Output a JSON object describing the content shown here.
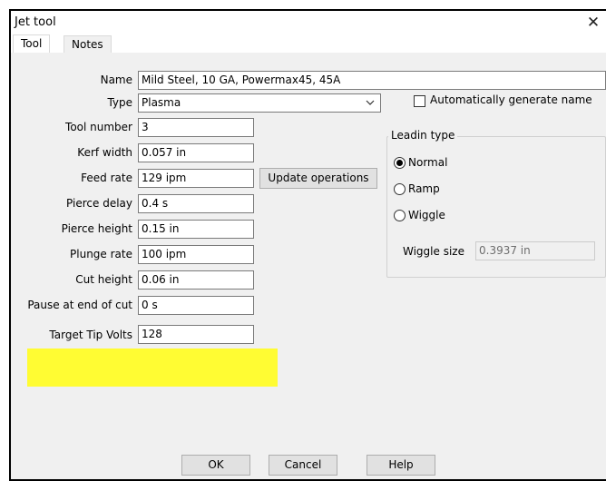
{
  "window": {
    "title": "Jet tool",
    "close_glyph": "✕"
  },
  "tabs": [
    {
      "label": "Tool",
      "active": true
    },
    {
      "label": "Notes",
      "active": false
    }
  ],
  "form": {
    "name": {
      "label": "Name",
      "value": "Mild Steel, 10 GA, Powermax45, 45A"
    },
    "type": {
      "label": "Type",
      "value": "Plasma"
    },
    "tool_number": {
      "label": "Tool number",
      "value": "3"
    },
    "kerf_width": {
      "label": "Kerf width",
      "value": "0.057 in"
    },
    "feed_rate": {
      "label": "Feed rate",
      "value": "129 ipm"
    },
    "pierce_delay": {
      "label": "Pierce delay",
      "value": "0.4 s"
    },
    "pierce_height": {
      "label": "Pierce height",
      "value": "0.15 in"
    },
    "plunge_rate": {
      "label": "Plunge rate",
      "value": "100 ipm"
    },
    "cut_height": {
      "label": "Cut height",
      "value": "0.06 in"
    },
    "pause_end": {
      "label": "Pause at end of cut",
      "value": "0 s"
    },
    "target_tip_volts": {
      "label": "Target Tip Volts",
      "value": "128"
    }
  },
  "update_operations_label": "Update operations",
  "auto_name": {
    "label": "Automatically generate name",
    "checked": false
  },
  "leadin": {
    "title": "Leadin type",
    "options": [
      {
        "label": "Normal",
        "selected": true
      },
      {
        "label": "Ramp",
        "selected": false
      },
      {
        "label": "Wiggle",
        "selected": false
      }
    ],
    "wiggle_size": {
      "label": "Wiggle size",
      "value": "0.3937 in",
      "enabled": false
    }
  },
  "footer": {
    "ok": "OK",
    "cancel": "Cancel",
    "help": "Help"
  },
  "colors": {
    "highlight": "#fffc33",
    "window_bg": "#f0f0f0"
  }
}
